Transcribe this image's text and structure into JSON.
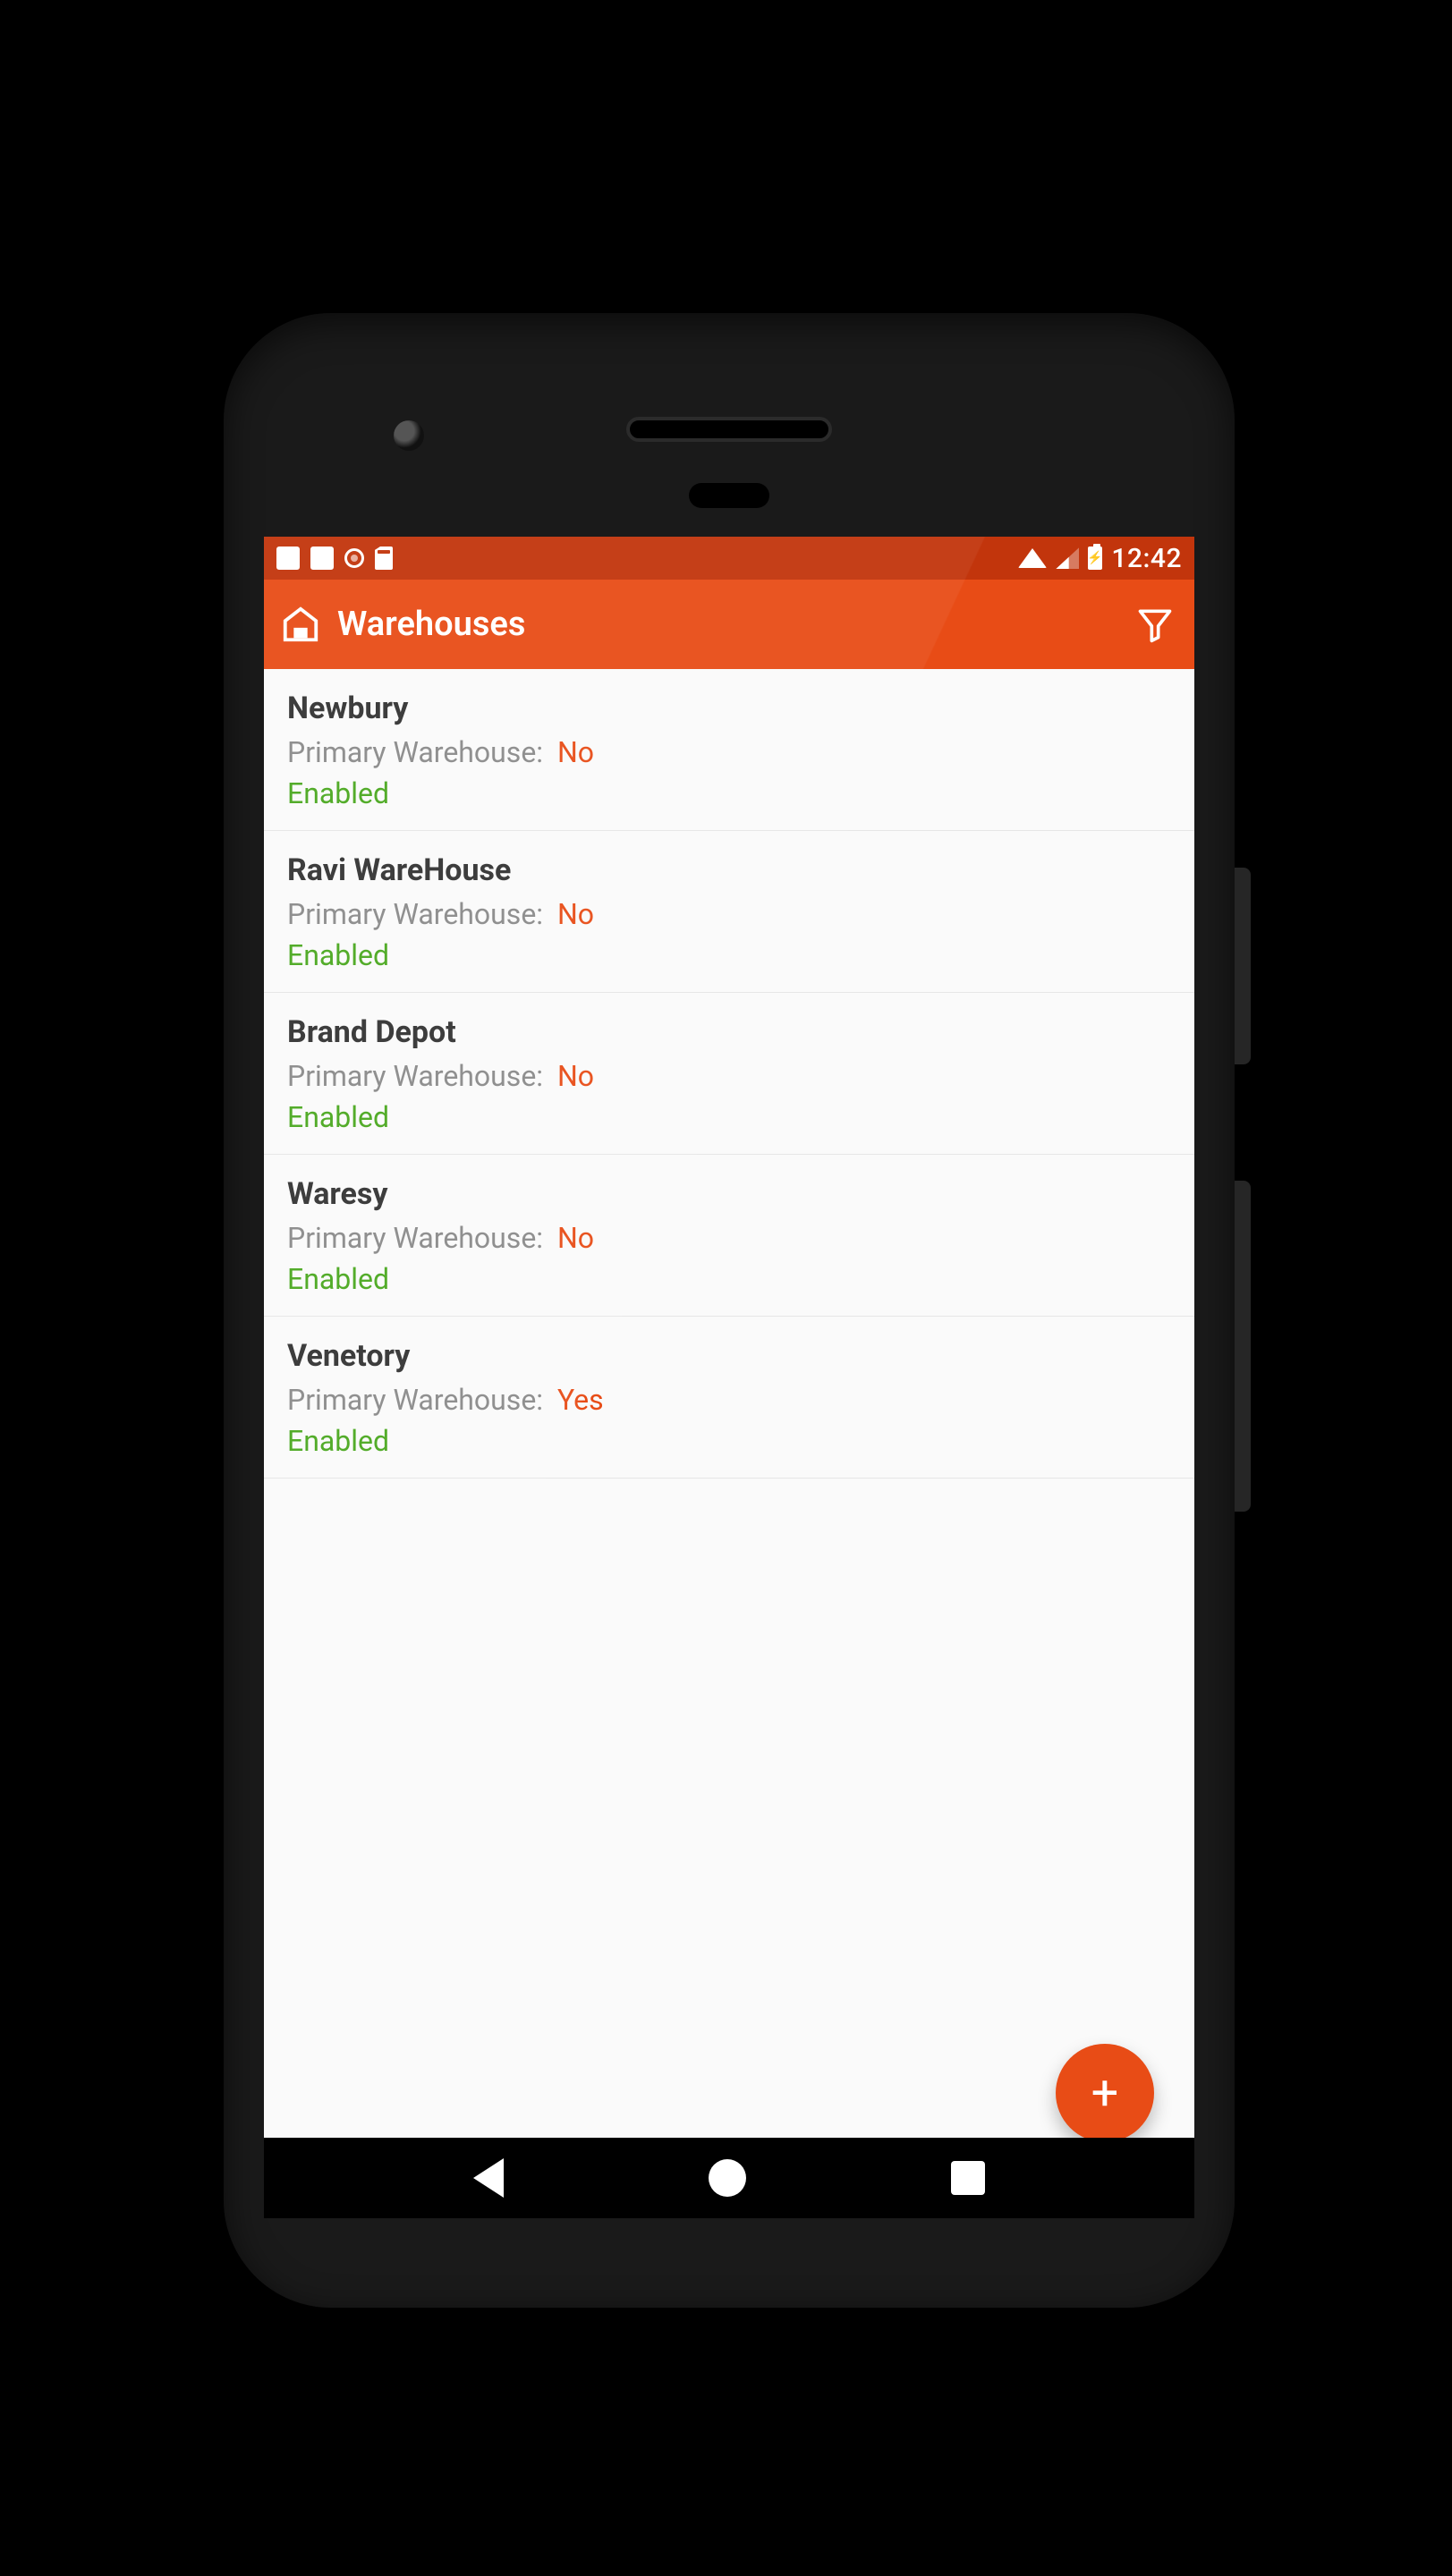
{
  "status": {
    "time": "12:42"
  },
  "appbar": {
    "title": "Warehouses"
  },
  "labels": {
    "primary": "Primary Warehouse:",
    "enabled": "Enabled"
  },
  "rows": [
    {
      "name": "Newbury",
      "primary": "No",
      "status": "Enabled"
    },
    {
      "name": "Ravi WareHouse",
      "primary": "No",
      "status": "Enabled"
    },
    {
      "name": "Brand Depot",
      "primary": "No",
      "status": "Enabled"
    },
    {
      "name": "Waresy",
      "primary": "No",
      "status": "Enabled"
    },
    {
      "name": "Venetory",
      "primary": "Yes",
      "status": "Enabled"
    }
  ]
}
